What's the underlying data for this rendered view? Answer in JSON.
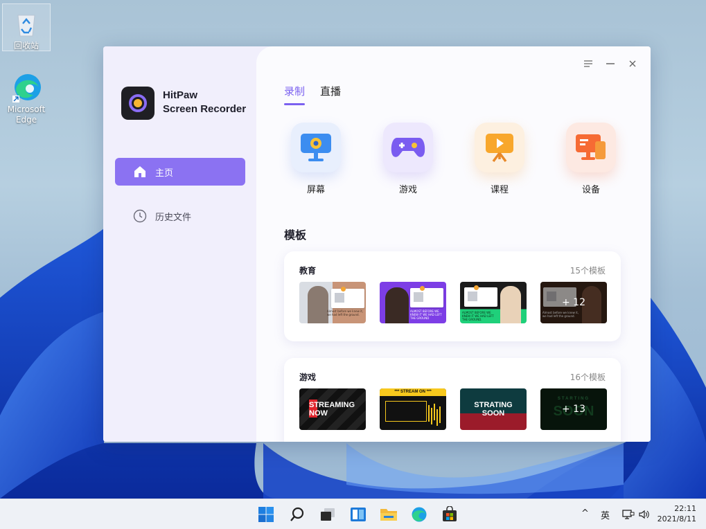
{
  "desktop": {
    "icons": [
      {
        "label": "回收站",
        "icon": "recycle-bin-icon"
      },
      {
        "label": "Microsoft Edge",
        "icon": "edge-icon"
      }
    ]
  },
  "app": {
    "title_line1": "HitPaw",
    "title_line2": "Screen Recorder",
    "logo_icon": "hitpaw-logo-icon",
    "accent_color": "#8b72f2",
    "sidebar": {
      "items": [
        {
          "label": "主页",
          "icon": "home-icon",
          "active": true
        },
        {
          "label": "历史文件",
          "icon": "clock-icon",
          "active": false
        }
      ]
    },
    "window_controls": [
      "menu-icon",
      "minimize-icon",
      "close-icon"
    ],
    "tabs": [
      {
        "label": "录制",
        "active": true
      },
      {
        "label": "直播",
        "active": false
      }
    ],
    "modes": [
      {
        "label": "屏幕",
        "icon": "monitor-icon"
      },
      {
        "label": "游戏",
        "icon": "gamepad-icon"
      },
      {
        "label": "课程",
        "icon": "presentation-icon"
      },
      {
        "label": "设备",
        "icon": "device-icon"
      }
    ],
    "templates_title": "模板",
    "template_groups": [
      {
        "name": "教育",
        "count": "15个模板",
        "thumbs": [
          {
            "caption": "Almost before we knew it, we had left the ground."
          },
          {
            "caption": "ALMOST BEFORE WE KNEW IT WE HAD LEFT THE GROUND"
          },
          {
            "caption": "ALMOST BEFORE WE KNEW IT WE HAD LEFT THE GROUND."
          },
          {
            "caption": "Almost before we knew it, we had left the ground.",
            "more": "+ 12"
          }
        ]
      },
      {
        "name": "游戏",
        "count": "16个模板",
        "thumbs": [
          {
            "text_line1": "STREAMING",
            "text_line2": "NOW"
          },
          {
            "text_line1": "*** STREAM ON ***"
          },
          {
            "text_line1": "STRATING",
            "text_line2": "SOON"
          },
          {
            "text_line1": "STARTING",
            "text_line2": "SOON",
            "more": "+ 13"
          }
        ]
      }
    ]
  },
  "taskbar": {
    "icons": [
      "start-icon",
      "search-icon",
      "task-view-icon",
      "widgets-icon",
      "file-explorer-icon",
      "edge-icon",
      "store-icon"
    ],
    "tray": {
      "chevron": "^",
      "ime": "英"
    },
    "time": "22:11",
    "date": "2021/8/11"
  }
}
